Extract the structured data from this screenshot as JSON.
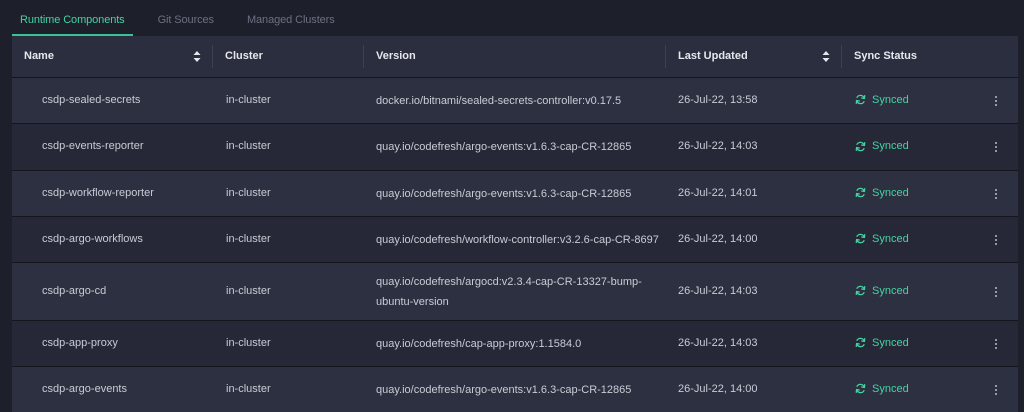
{
  "tabs": [
    {
      "label": "Runtime Components",
      "active": true
    },
    {
      "label": "Git Sources",
      "active": false
    },
    {
      "label": "Managed Clusters",
      "active": false
    }
  ],
  "columns": {
    "name": "Name",
    "cluster": "Cluster",
    "version": "Version",
    "last_updated": "Last Updated",
    "sync_status": "Sync Status"
  },
  "rows": [
    {
      "name": "csdp-sealed-secrets",
      "cluster": "in-cluster",
      "version": [
        "docker.io/bitnami/sealed-secrets-controller:v0.17.5"
      ],
      "updated": "26-Jul-22, 13:58",
      "status": "Synced"
    },
    {
      "name": "csdp-events-reporter",
      "cluster": "in-cluster",
      "version": [
        "quay.io/codefresh/argo-events:v1.6.3-cap-CR-12865"
      ],
      "updated": "26-Jul-22, 14:03",
      "status": "Synced"
    },
    {
      "name": "csdp-workflow-reporter",
      "cluster": "in-cluster",
      "version": [
        "quay.io/codefresh/argo-events:v1.6.3-cap-CR-12865"
      ],
      "updated": "26-Jul-22, 14:01",
      "status": "Synced"
    },
    {
      "name": "csdp-argo-workflows",
      "cluster": "in-cluster",
      "version": [
        "quay.io/codefresh/workflow-controller:v3.2.6-cap-CR-8697"
      ],
      "updated": "26-Jul-22, 14:00",
      "status": "Synced"
    },
    {
      "name": "csdp-argo-cd",
      "cluster": "in-cluster",
      "version": [
        "quay.io/codefresh/argocd:v2.3.4-cap-CR-13327-bump-",
        "ubuntu-version"
      ],
      "updated": "26-Jul-22, 14:03",
      "status": "Synced"
    },
    {
      "name": "csdp-app-proxy",
      "cluster": "in-cluster",
      "version": [
        "quay.io/codefresh/cap-app-proxy:1.1584.0"
      ],
      "updated": "26-Jul-22, 14:03",
      "status": "Synced"
    },
    {
      "name": "csdp-argo-events",
      "cluster": "in-cluster",
      "version": [
        "quay.io/codefresh/argo-events:v1.6.3-cap-CR-12865"
      ],
      "updated": "26-Jul-22, 14:00",
      "status": "Synced"
    }
  ],
  "colors": {
    "accent": "#44d3a2"
  },
  "icons": {
    "sort": "sort-icon",
    "sync": "sync-icon",
    "menu": "kebab-menu-icon"
  }
}
